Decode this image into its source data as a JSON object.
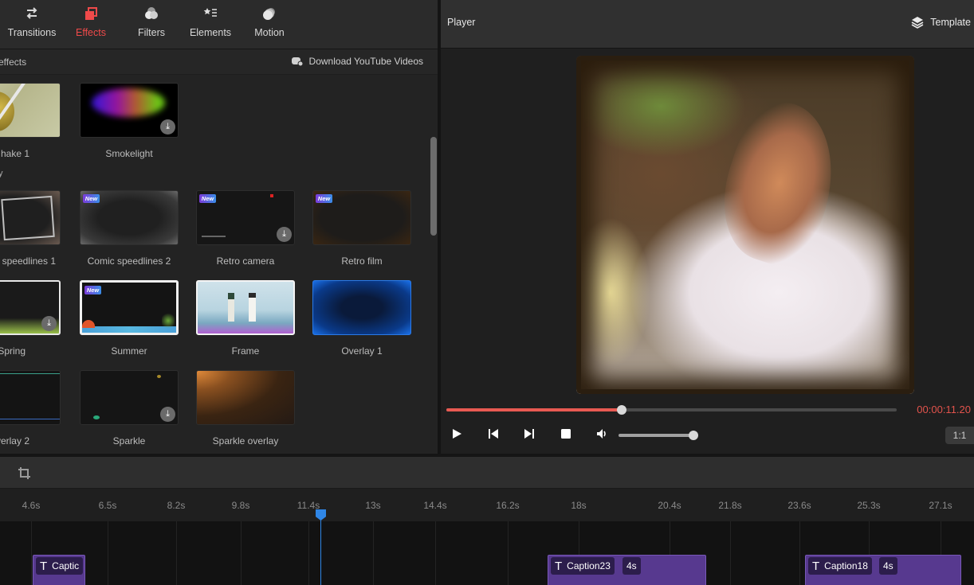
{
  "tabs": [
    {
      "label": "Transitions",
      "icon": "transitions-icon",
      "active": false
    },
    {
      "label": "Effects",
      "icon": "effects-icon",
      "active": true
    },
    {
      "label": "Filters",
      "icon": "filters-icon",
      "active": false
    },
    {
      "label": "Elements",
      "icon": "elements-icon",
      "active": false
    },
    {
      "label": "Motion",
      "icon": "motion-icon",
      "active": false
    }
  ],
  "subbar": {
    "title": "effects",
    "download_label": "Download YouTube Videos"
  },
  "section_mark": "y",
  "effects": [
    {
      "name": "hake 1",
      "new": false,
      "download": false
    },
    {
      "name": "Smokelight",
      "new": false,
      "download": true
    },
    {
      "name": "speedlines 1",
      "new": false,
      "download": false
    },
    {
      "name": "Comic speedlines 2",
      "new": true,
      "download": false
    },
    {
      "name": "Retro camera",
      "new": true,
      "download": true
    },
    {
      "name": "Retro film",
      "new": true,
      "download": false
    },
    {
      "name": "Spring",
      "new": false,
      "download": true
    },
    {
      "name": "Summer",
      "new": true,
      "download": false
    },
    {
      "name": "Frame",
      "new": false,
      "download": false
    },
    {
      "name": "Overlay 1",
      "new": false,
      "download": false
    },
    {
      "name": "verlay 2",
      "new": false,
      "download": false
    },
    {
      "name": "Sparkle",
      "new": false,
      "download": true
    },
    {
      "name": "Sparkle overlay",
      "new": false,
      "download": false
    }
  ],
  "badge_new": "New",
  "player": {
    "title": "Player",
    "template_label": "Template",
    "timecode": "00:00:11.20",
    "progress_fraction": 0.39,
    "volume_fraction": 1.0,
    "ratio_label": "1:1"
  },
  "colors": {
    "accent_red": "#f04a4a",
    "progress_red": "#e85a52",
    "playhead_blue": "#2f86e6",
    "clip_purple": "#57398f"
  },
  "timeline": {
    "ticks": [
      "4.6s",
      "6.5s",
      "8.2s",
      "9.8s",
      "11.4s",
      "13s",
      "14.4s",
      "16.2s",
      "18s",
      "20.4s",
      "21.8s",
      "23.6s",
      "25.3s",
      "27.1s"
    ],
    "clips": [
      {
        "label": "Captic",
        "duration": ""
      },
      {
        "label": "Caption23",
        "duration": "4s"
      },
      {
        "label": "Caption18",
        "duration": "4s"
      }
    ]
  }
}
